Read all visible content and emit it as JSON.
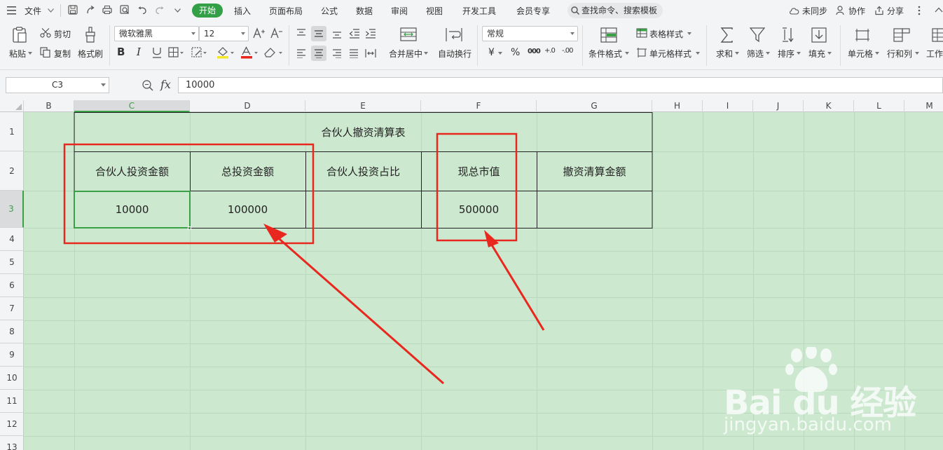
{
  "menu": {
    "file": "文件",
    "tabs": [
      "开始",
      "插入",
      "页面布局",
      "公式",
      "数据",
      "审阅",
      "视图",
      "开发工具",
      "会员专享"
    ],
    "search_placeholder": "查找命令、搜索模板",
    "right": [
      "未同步",
      "协作",
      "分享"
    ]
  },
  "ribbon": {
    "paste": "粘贴",
    "cut": "剪切",
    "copy": "复制",
    "format_painter": "格式刷",
    "font_name": "微软雅黑",
    "font_size": "12",
    "merge_center": "合并居中",
    "auto_wrap": "自动换行",
    "number_format": "常规",
    "currency_symbol": "¥",
    "percent_symbol": "%",
    "thousands_symbol": "000",
    "increase_decimal": "+.0",
    "decrease_decimal": "-.00",
    "conditional_format": "条件格式",
    "table_style": "表格样式",
    "cell_style": "单元格样式",
    "sum": "求和",
    "filter": "筛选",
    "sort": "排序",
    "fill": "填充",
    "cell": "单元格",
    "row_col": "行和列",
    "worksheet": "工作"
  },
  "formula_bar": {
    "cell_ref": "C3",
    "fx": "fx",
    "value": "10000"
  },
  "columns": [
    "B",
    "C",
    "D",
    "E",
    "F",
    "G",
    "H",
    "I",
    "J",
    "K",
    "L",
    "M"
  ],
  "rows": [
    "1",
    "2",
    "3",
    "4",
    "5",
    "6",
    "7",
    "8",
    "9",
    "10",
    "11",
    "12",
    "13"
  ],
  "sheet": {
    "title": "合伙人撤资清算表",
    "headers": [
      "合伙人投资金额",
      "总投资金额",
      "合伙人投资占比",
      "现总市值",
      "撤资清算金额"
    ],
    "values": [
      "10000",
      "100000",
      "",
      "500000",
      ""
    ]
  },
  "watermark": {
    "brand": "Bai du 经验",
    "url": "jingyan.baidu.com"
  },
  "colors": {
    "accent": "#33a047",
    "sheet_bg": "#cce8cf",
    "annotation": "#e8281e"
  }
}
